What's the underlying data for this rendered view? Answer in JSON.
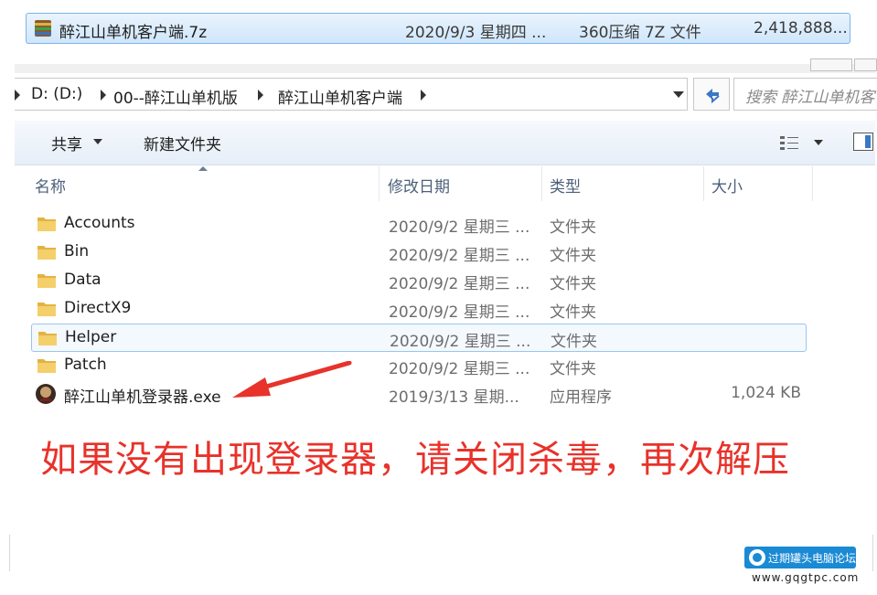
{
  "archive": {
    "name": "醉江山单机客户端.7z",
    "date": "2020/9/3 星期四 ...",
    "type": "360压缩 7Z 文件",
    "size": "2,418,888..."
  },
  "address": {
    "crumbs": [
      "D: (D:)",
      "00--醉江山单机版",
      "醉江山单机客户端"
    ]
  },
  "search": {
    "placeholder": "搜索 醉江山单机客"
  },
  "toolbar": {
    "share_label": "共享",
    "new_folder_label": "新建文件夹"
  },
  "columns": {
    "name": "名称",
    "date": "修改日期",
    "type": "类型",
    "size": "大小"
  },
  "files": [
    {
      "name": "Accounts",
      "date": "2020/9/2 星期三 ...",
      "type": "文件夹",
      "size": "",
      "icon": "folder-icon"
    },
    {
      "name": "Bin",
      "date": "2020/9/2 星期三 ...",
      "type": "文件夹",
      "size": "",
      "icon": "folder-icon"
    },
    {
      "name": "Data",
      "date": "2020/9/2 星期三 ...",
      "type": "文件夹",
      "size": "",
      "icon": "folder-icon"
    },
    {
      "name": "DirectX9",
      "date": "2020/9/2 星期三 ...",
      "type": "文件夹",
      "size": "",
      "icon": "folder-icon"
    },
    {
      "name": "Helper",
      "date": "2020/9/2 星期三 ...",
      "type": "文件夹",
      "size": "",
      "icon": "folder-icon",
      "selected": true
    },
    {
      "name": "Patch",
      "date": "2020/9/2 星期三 ...",
      "type": "文件夹",
      "size": "",
      "icon": "folder-icon"
    },
    {
      "name": "醉江山单机登录器.exe",
      "date": "2019/3/13 星期...",
      "type": "应用程序",
      "size": "1,024 KB",
      "icon": "exe-icon"
    }
  ],
  "annotation": "如果没有出现登录器，请关闭杀毒，再次解压",
  "watermark": {
    "text": "过期罐头电脑论坛",
    "url": "www.gqgtpc.com"
  },
  "colors": {
    "annotation": "#e8322a",
    "selection_border": "#9dc3ee",
    "watermark_bg": "#1a8ad4"
  }
}
